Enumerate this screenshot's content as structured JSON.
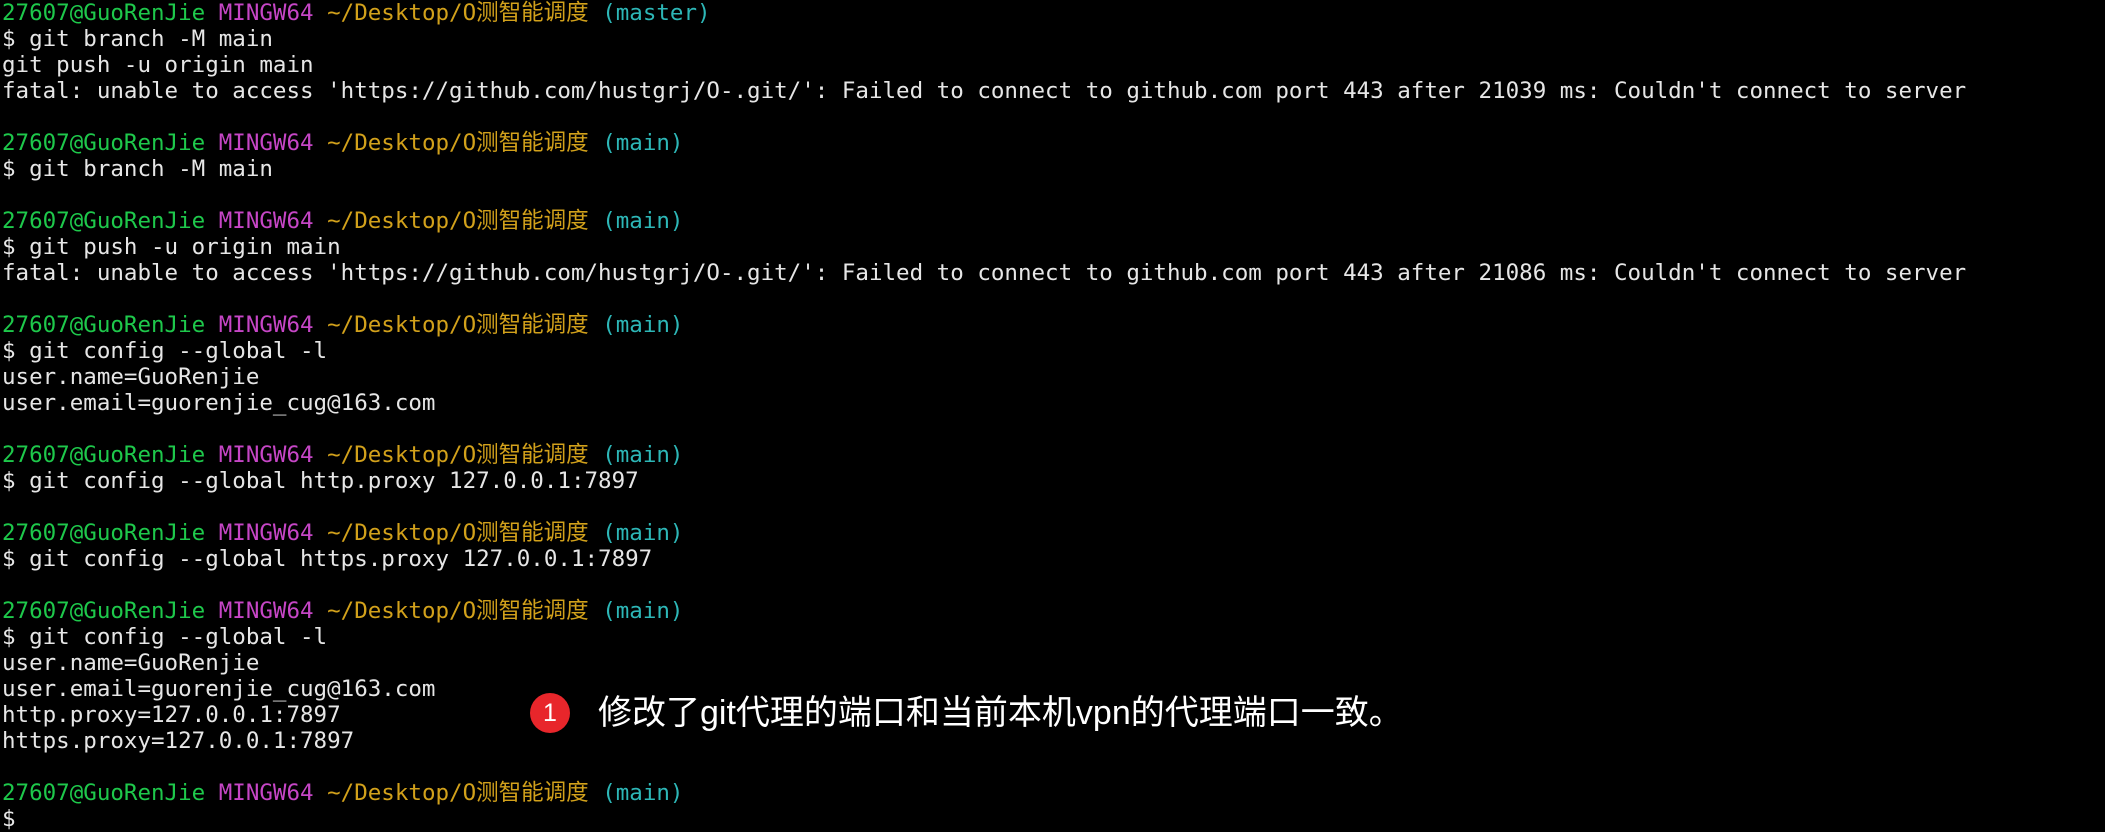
{
  "terminal": {
    "lines": [
      [
        {
          "t": "27607@GuoRenJie",
          "c": "user"
        },
        {
          "t": " "
        },
        {
          "t": "MINGW64",
          "c": "host"
        },
        {
          "t": " "
        },
        {
          "t": "~/Desktop/O测智能调度",
          "c": "path"
        },
        {
          "t": " "
        },
        {
          "t": "(master)",
          "c": "branch"
        }
      ],
      [
        {
          "t": "$ git branch -M main"
        }
      ],
      [
        {
          "t": "git push -u origin main"
        }
      ],
      [
        {
          "t": "fatal: unable to access 'https://github.com/hustgrj/O-.git/': Failed to connect to github.com port 443 after 21039 ms: Couldn't connect to server"
        }
      ],
      [],
      [
        {
          "t": "27607@GuoRenJie",
          "c": "user"
        },
        {
          "t": " "
        },
        {
          "t": "MINGW64",
          "c": "host"
        },
        {
          "t": " "
        },
        {
          "t": "~/Desktop/O测智能调度",
          "c": "path"
        },
        {
          "t": " "
        },
        {
          "t": "(main)",
          "c": "branch"
        }
      ],
      [
        {
          "t": "$ git branch -M main"
        }
      ],
      [],
      [
        {
          "t": "27607@GuoRenJie",
          "c": "user"
        },
        {
          "t": " "
        },
        {
          "t": "MINGW64",
          "c": "host"
        },
        {
          "t": " "
        },
        {
          "t": "~/Desktop/O测智能调度",
          "c": "path"
        },
        {
          "t": " "
        },
        {
          "t": "(main)",
          "c": "branch"
        }
      ],
      [
        {
          "t": "$ git push -u origin main"
        }
      ],
      [
        {
          "t": "fatal: unable to access 'https://github.com/hustgrj/O-.git/': Failed to connect to github.com port 443 after 21086 ms: Couldn't connect to server"
        }
      ],
      [],
      [
        {
          "t": "27607@GuoRenJie",
          "c": "user"
        },
        {
          "t": " "
        },
        {
          "t": "MINGW64",
          "c": "host"
        },
        {
          "t": " "
        },
        {
          "t": "~/Desktop/O测智能调度",
          "c": "path"
        },
        {
          "t": " "
        },
        {
          "t": "(main)",
          "c": "branch"
        }
      ],
      [
        {
          "t": "$ git config --global -l"
        }
      ],
      [
        {
          "t": "user.name=GuoRenjie"
        }
      ],
      [
        {
          "t": "user.email=guorenjie_cug@163.com"
        }
      ],
      [],
      [
        {
          "t": "27607@GuoRenJie",
          "c": "user"
        },
        {
          "t": " "
        },
        {
          "t": "MINGW64",
          "c": "host"
        },
        {
          "t": " "
        },
        {
          "t": "~/Desktop/O测智能调度",
          "c": "path"
        },
        {
          "t": " "
        },
        {
          "t": "(main)",
          "c": "branch"
        }
      ],
      [
        {
          "t": "$ git config --global http.proxy 127.0.0.1:7897"
        }
      ],
      [],
      [
        {
          "t": "27607@GuoRenJie",
          "c": "user"
        },
        {
          "t": " "
        },
        {
          "t": "MINGW64",
          "c": "host"
        },
        {
          "t": " "
        },
        {
          "t": "~/Desktop/O测智能调度",
          "c": "path"
        },
        {
          "t": " "
        },
        {
          "t": "(main)",
          "c": "branch"
        }
      ],
      [
        {
          "t": "$ git config --global https.proxy 127.0.0.1:7897"
        }
      ],
      [],
      [
        {
          "t": "27607@GuoRenJie",
          "c": "user"
        },
        {
          "t": " "
        },
        {
          "t": "MINGW64",
          "c": "host"
        },
        {
          "t": " "
        },
        {
          "t": "~/Desktop/O测智能调度",
          "c": "path"
        },
        {
          "t": " "
        },
        {
          "t": "(main)",
          "c": "branch"
        }
      ],
      [
        {
          "t": "$ git config --global -l"
        }
      ],
      [
        {
          "t": "user.name=GuoRenjie"
        }
      ],
      [
        {
          "t": "user.email=guorenjie_cug@163.com"
        }
      ],
      [
        {
          "t": "http.proxy=127.0.0.1:7897"
        }
      ],
      [
        {
          "t": "https.proxy=127.0.0.1:7897"
        }
      ],
      [],
      [
        {
          "t": "27607@GuoRenJie",
          "c": "user"
        },
        {
          "t": " "
        },
        {
          "t": "MINGW64",
          "c": "host"
        },
        {
          "t": " "
        },
        {
          "t": "~/Desktop/O测智能调度",
          "c": "path"
        },
        {
          "t": " "
        },
        {
          "t": "(main)",
          "c": "branch"
        }
      ],
      [
        {
          "t": "$"
        }
      ]
    ]
  },
  "annotation": {
    "badge_number": "1",
    "text": "修改了git代理的端口和当前本机vpn的代理端口一致。"
  },
  "colors": {
    "background": "#000000",
    "user": "#1ec84b",
    "host": "#c646c6",
    "path": "#d2a11b",
    "branch": "#2db7b7",
    "text": "#e6e6e6",
    "badge": "#e8262b"
  }
}
